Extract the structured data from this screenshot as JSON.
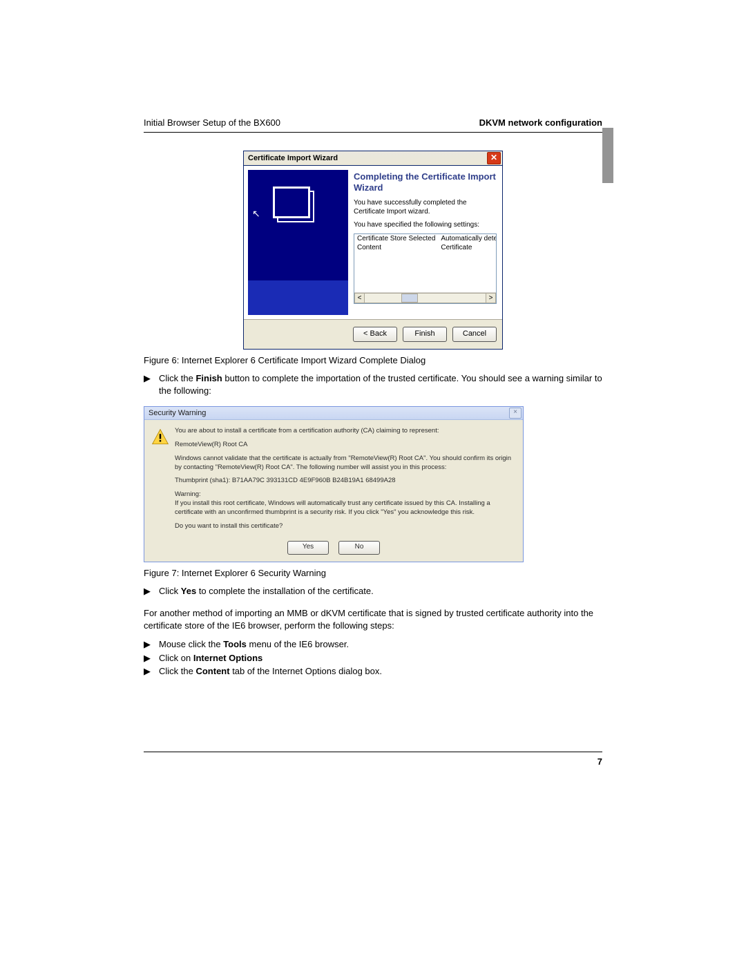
{
  "header": {
    "left": "Initial Browser Setup of the BX600",
    "right": "DKVM network configuration"
  },
  "side_tab": "",
  "wizard": {
    "title": "Certificate Import Wizard",
    "heading": "Completing the Certificate Import Wizard",
    "line1": "You have successfully completed the Certificate Import wizard.",
    "line2": "You have specified the following settings:",
    "rows": [
      {
        "k": "Certificate Store Selected",
        "v": "Automatically determined by t"
      },
      {
        "k": "Content",
        "v": "Certificate"
      }
    ],
    "scroll": {
      "left": "<",
      "right": ">"
    },
    "buttons": {
      "back": "< Back",
      "finish": "Finish",
      "cancel": "Cancel"
    }
  },
  "fig6": "Figure 6: Internet Explorer 6 Certificate Import Wizard Complete Dialog",
  "bullets1": {
    "a_pre": "Click the ",
    "a_b": "Finish",
    "a_post": " button to complete the importation of the trusted certificate. You should see a warning similar to the following:"
  },
  "security": {
    "title": "Security Warning",
    "p1": "You are about to install a certificate from a certification authority (CA) claiming to represent:",
    "p2": "RemoteView(R) Root CA",
    "p3": "Windows cannot validate that the certificate is actually from \"RemoteView(R) Root CA\". You should confirm its origin by contacting \"RemoteView(R) Root CA\". The following number will assist you in this process:",
    "p4": "Thumbprint (sha1): B71AA79C 393131CD 4E9F960B B24B19A1 68499A28",
    "p5a": "Warning:",
    "p5b": "If you install this root certificate, Windows will automatically trust any certificate issued by this CA. Installing a certificate with an unconfirmed thumbprint is a security risk. If you click \"Yes\" you acknowledge this risk.",
    "p6": "Do you want to install this certificate?",
    "yes": "Yes",
    "no": "No"
  },
  "fig7": "Figure 7: Internet Explorer 6 Security Warning",
  "bullets2": {
    "a_pre": "Click ",
    "a_b": "Yes",
    "a_post": " to complete the installation of the certificate."
  },
  "para": "For another method of importing an MMB or dKVM certificate that is signed by trusted certificate authority into the certificate store of the IE6 browser, perform the following steps:",
  "bullets3": {
    "a_pre": "Mouse click the ",
    "a_b": "Tools",
    "a_post": " menu of the IE6 browser.",
    "b_pre": "Click on ",
    "b_b": "Internet Options",
    "b_post": "",
    "c_pre": "Click the ",
    "c_b": "Content",
    "c_post": " tab of the Internet Options dialog box."
  },
  "page_number": "7"
}
